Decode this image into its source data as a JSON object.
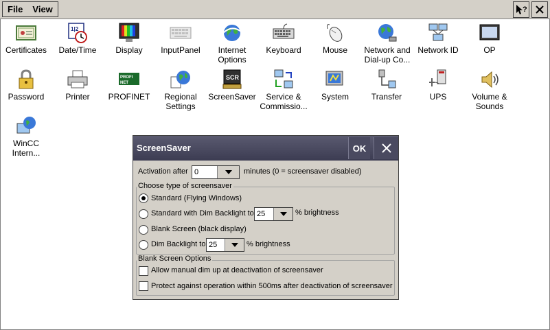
{
  "menubar": {
    "file": "File",
    "view": "View",
    "help_icon": "help-cursor-icon",
    "close_icon": "close-icon"
  },
  "icons": [
    {
      "label": "Certificates"
    },
    {
      "label": "Date/Time"
    },
    {
      "label": "Display"
    },
    {
      "label": "InputPanel"
    },
    {
      "label": "Internet Options"
    },
    {
      "label": "Keyboard"
    },
    {
      "label": "Mouse"
    },
    {
      "label": "Network and Dial-up Co..."
    },
    {
      "label": "Network ID"
    },
    {
      "label": "OP"
    },
    {
      "label": "Password"
    },
    {
      "label": "Printer"
    },
    {
      "label": "PROFINET"
    },
    {
      "label": "Regional Settings"
    },
    {
      "label": "ScreenSaver"
    },
    {
      "label": "Service & Commissio..."
    },
    {
      "label": "System"
    },
    {
      "label": "Transfer"
    },
    {
      "label": "UPS"
    },
    {
      "label": "Volume & Sounds"
    },
    {
      "label": "WinCC Intern..."
    }
  ],
  "dialog": {
    "title": "ScreenSaver",
    "ok": "OK",
    "activation_label": "Activation after",
    "activation_value": "0",
    "activation_hint": "minutes (0 = screensaver disabled)",
    "choose_type_label": "Choose type of screensaver",
    "opt_standard": "Standard (Flying Windows)",
    "opt_dim_standard": "Standard with Dim Backlight to",
    "dim_standard_value": "25",
    "brightness_suffix_1": "% brightness",
    "opt_blank": "Blank Screen (black display)",
    "opt_dim": "Dim Backlight to",
    "dim_value": "25",
    "brightness_suffix_2": "% brightness",
    "blank_options_label": "Blank Screen Options",
    "chk_manual_dim": "Allow manual dim up at deactivation of screensaver",
    "chk_protect": "Protect against operation within 500ms after deactivation of screensaver",
    "selected_option": "standard"
  }
}
